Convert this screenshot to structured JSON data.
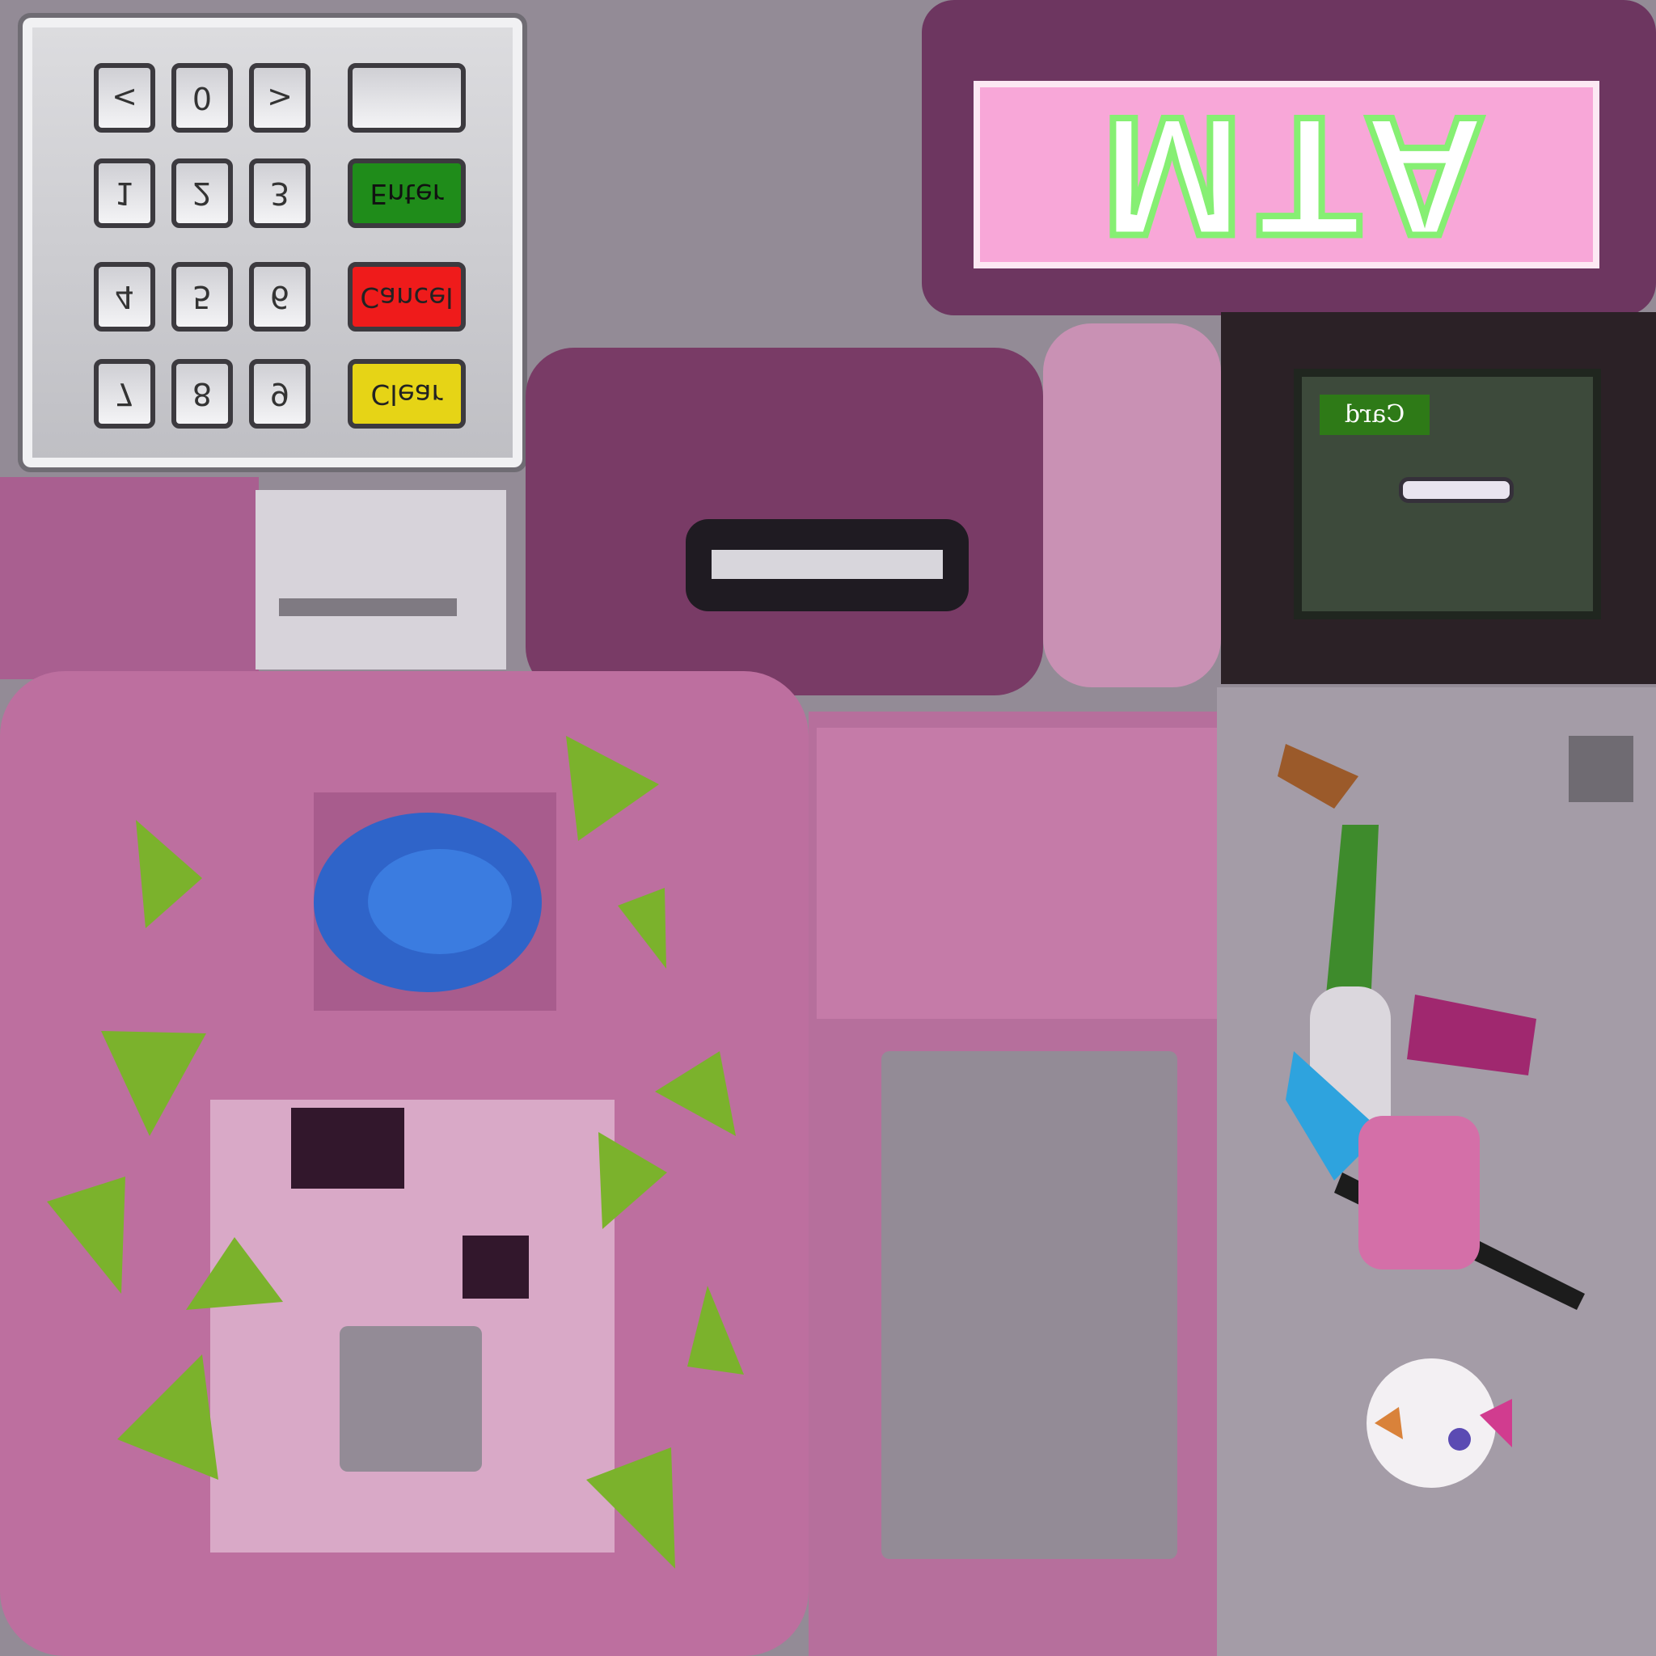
{
  "keypad": {
    "keys": [
      "<",
      "0",
      ">",
      "1",
      "2",
      "3",
      "4",
      "5",
      "6",
      "7",
      "8",
      "9"
    ],
    "enter_label": "Enter",
    "cancel_label": "Cancel",
    "clear_label": "Clear",
    "enter_symbol": "○",
    "cancel_symbol": "×",
    "clear_symbol": "|"
  },
  "banner": {
    "text": "ATM"
  },
  "reader": {
    "label": "Card"
  },
  "colors": {
    "panel_pink": "#bd6f9f",
    "dark_plum": "#6d3660",
    "banner_pink": "#f8a7d8",
    "banner_outline": "#86ef73",
    "accent_green": "#7bb22c",
    "enter_green": "#1f8c1a",
    "cancel_red": "#ef1b1b",
    "clear_yellow": "#e6d416",
    "button_blue": "#2f64c9"
  }
}
